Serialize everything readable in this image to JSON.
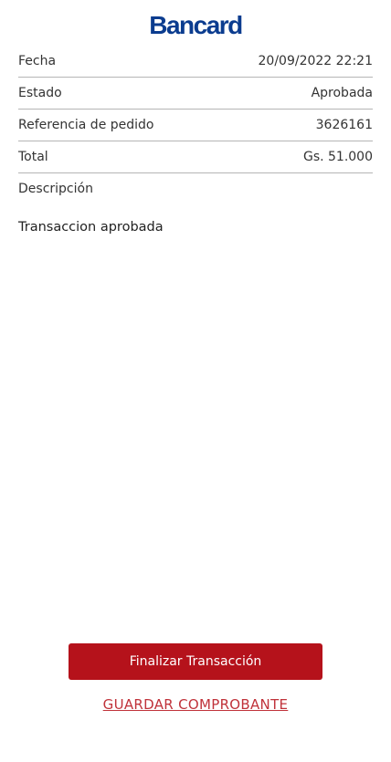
{
  "brand": {
    "name": "Bancard",
    "color": "#0b3c8f"
  },
  "details": {
    "rows": [
      {
        "label": "Fecha",
        "value": "20/09/2022 22:21"
      },
      {
        "label": "Estado",
        "value": "Aprobada"
      },
      {
        "label": "Referencia de pedido",
        "value": "3626161"
      },
      {
        "label": "Total",
        "value": "Gs. 51.000"
      },
      {
        "label": "Descripción",
        "value": ""
      }
    ]
  },
  "message": "Transaccion aprobada",
  "actions": {
    "finalize_label": "Finalizar Transacción",
    "finalize_color": "#b5121b",
    "save_receipt_label": "GUARDAR COMPROBANTE"
  }
}
